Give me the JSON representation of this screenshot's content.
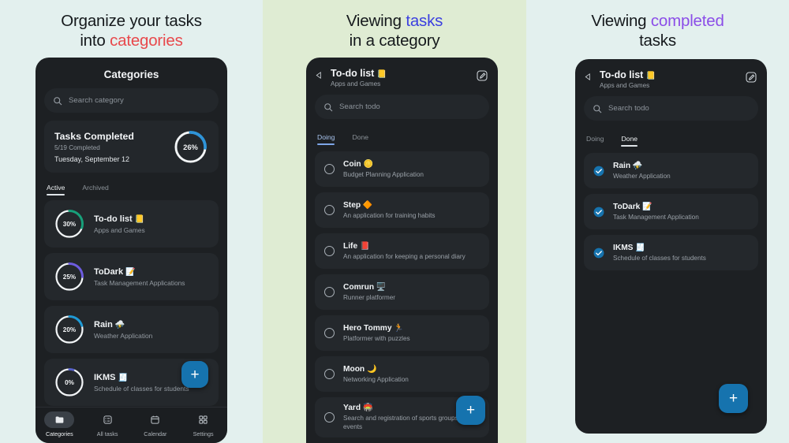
{
  "colors": {
    "accent_blue": "#1673ae",
    "headline_red": "#e8494c",
    "headline_blue": "#3b3fe0",
    "headline_purple": "#8b4de8",
    "panel1_bg": "#e3f0ee",
    "panel2_bg": "#dfecd3",
    "panel3_bg": "#e3f0ee",
    "card_bg": "#24282c",
    "phone_bg": "#1d2023"
  },
  "panel1": {
    "headline_line1": "Organize your tasks",
    "headline_line2_plain": "into ",
    "headline_line2_accent": "categories",
    "app_title": "Categories",
    "search": {
      "placeholder": "Search category",
      "icon": "search-icon"
    },
    "summary": {
      "title": "Tasks Completed",
      "subtitle": "5/19 Completed",
      "date": "Tuesday, September 12",
      "percent_label": "26%",
      "percent_value": 26,
      "ring_color": "#2f94d8",
      "track_color": "#f2f5f7"
    },
    "tabs": [
      {
        "label": "Active",
        "active": true
      },
      {
        "label": "Archived",
        "active": false
      }
    ],
    "categories": [
      {
        "name": "To-do list",
        "emoji": "📒",
        "subtitle": "Apps and Games",
        "percent_label": "30%",
        "percent_value": 30,
        "ring_color": "#17a07a"
      },
      {
        "name": "ToDark",
        "emoji": "📝",
        "subtitle": "Task Management Applications",
        "percent_label": "25%",
        "percent_value": 25,
        "ring_color": "#6d5ce0"
      },
      {
        "name": "Rain",
        "emoji": "⛈️",
        "subtitle": "Weather Application",
        "percent_label": "20%",
        "percent_value": 20,
        "ring_color": "#1f9ad6"
      },
      {
        "name": "IKMS",
        "emoji": "🧾",
        "subtitle": "Schedule of classes for students",
        "percent_label": "0%",
        "percent_value": 4,
        "ring_color": "#5560c8"
      }
    ],
    "fab": {
      "label": "+",
      "icon": "plus-icon"
    },
    "bottom_nav": [
      {
        "label": "Categories",
        "icon": "folder-icon",
        "active": true
      },
      {
        "label": "All tasks",
        "icon": "list-check-icon",
        "active": false
      },
      {
        "label": "Calendar",
        "icon": "calendar-icon",
        "active": false
      },
      {
        "label": "Settings",
        "icon": "grid-icon",
        "active": false
      }
    ]
  },
  "panel2": {
    "headline_line1_plain": "Viewing ",
    "headline_line1_accent": "tasks",
    "headline_line2": "in a category",
    "header": {
      "title": "To-do list",
      "emoji": "📒",
      "subtitle": "Apps and Games",
      "back_icon": "back-arrow-icon",
      "edit_icon": "edit-pencil-icon"
    },
    "search": {
      "placeholder": "Search todo",
      "icon": "search-icon"
    },
    "tabs": [
      {
        "label": "Doing",
        "active": true
      },
      {
        "label": "Done",
        "active": false
      }
    ],
    "tasks": [
      {
        "name": "Coin",
        "emoji": "🪙",
        "subtitle": "Budget Planning Application",
        "done": false
      },
      {
        "name": "Step",
        "emoji": "🔶",
        "subtitle": "An application for training habits",
        "done": false
      },
      {
        "name": "Life",
        "emoji": "📕",
        "subtitle": "An application for keeping a personal diary",
        "done": false
      },
      {
        "name": "Comrun",
        "emoji": "🖥️",
        "subtitle": "Runner platformer",
        "done": false
      },
      {
        "name": "Hero Tommy",
        "emoji": "🏃",
        "subtitle": "Platformer with puzzles",
        "done": false
      },
      {
        "name": "Moon",
        "emoji": "🌙",
        "subtitle": "Networking Application",
        "done": false
      },
      {
        "name": "Yard",
        "emoji": "🏟️",
        "subtitle": "Search and registration of sports groups and events",
        "done": false
      }
    ],
    "fab": {
      "label": "+",
      "icon": "plus-icon"
    }
  },
  "panel3": {
    "headline_line1_plain": "Viewing ",
    "headline_line1_accent": "completed",
    "headline_line2": "tasks",
    "header": {
      "title": "To-do list",
      "emoji": "📒",
      "subtitle": "Apps and Games",
      "back_icon": "back-arrow-icon",
      "edit_icon": "edit-pencil-icon"
    },
    "search": {
      "placeholder": "Search todo",
      "icon": "search-icon"
    },
    "tabs": [
      {
        "label": "Doing",
        "active": false
      },
      {
        "label": "Done",
        "active": true
      }
    ],
    "tasks": [
      {
        "name": "Rain",
        "emoji": "⛈️",
        "subtitle": "Weather Application",
        "done": true
      },
      {
        "name": "ToDark",
        "emoji": "📝",
        "subtitle": "Task Management Application",
        "done": true
      },
      {
        "name": "IKMS",
        "emoji": "🧾",
        "subtitle": "Schedule of classes for students",
        "done": true
      }
    ],
    "fab": {
      "label": "+",
      "icon": "plus-icon"
    }
  }
}
